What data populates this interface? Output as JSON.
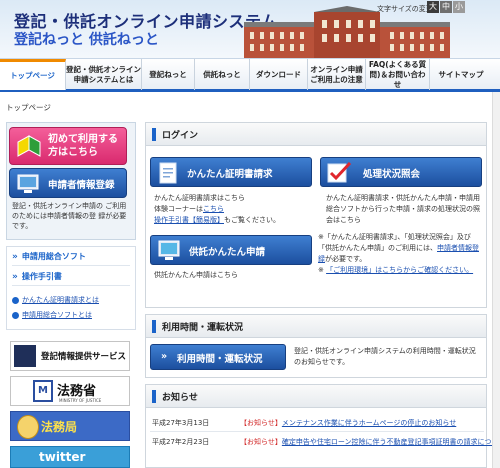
{
  "header": {
    "title": "登記・供託オンライン申請システム",
    "subtitle": "登記ねっと 供託ねっと",
    "font_size_label": "文字サイズの変更",
    "font_size_options": [
      "大",
      "中",
      "小"
    ]
  },
  "nav": {
    "items": [
      {
        "label": "トップページ",
        "active": true
      },
      {
        "label": "登記・供託オンライン申請システムとは",
        "active": false
      },
      {
        "label": "登記ねっと",
        "active": false
      },
      {
        "label": "供託ねっと",
        "active": false
      },
      {
        "label": "ダウンロード",
        "active": false
      },
      {
        "label": "オンライン申請ご利用上の注意",
        "active": false
      },
      {
        "label": "FAQ(よくある質問)＆お問い合わせ",
        "active": false
      },
      {
        "label": "サイトマップ",
        "active": false
      }
    ]
  },
  "breadcrumb": "トップページ",
  "left": {
    "first_time_button": "初めて利用する方はこちら",
    "register_button": "申請者情報登録",
    "register_note": "登記・供託オンライン申請の ご利用のためには申請者情報の登 録が必要です。",
    "links": [
      "申請用総合ソフト",
      "操作手引書"
    ],
    "sub_links": [
      "かんたん証明書請求とは",
      "申請用総合ソフトとは"
    ],
    "banners": {
      "touki": "登記情報提供サービス",
      "moj_mark": "M",
      "moj_title": "法務省",
      "moj_sub": "MINISTRY OF JUSTICE",
      "kyoku": "法務局",
      "twitter": "twitter"
    }
  },
  "login": {
    "heading": "ログイン",
    "cert_button": "かんたん証明書請求",
    "cert_text_1": "かんたん証明書請求はこちら",
    "cert_text_2_prefix": "体験コーナーは",
    "cert_text_2_link": "こちら",
    "cert_text_3_link": "操作手引書【簡易版】",
    "cert_text_3_suffix": "もご覧ください。",
    "deposit_button": "供託かんたん申請",
    "deposit_text": "供託かんたん申請はこちら",
    "status_button": "処理状況照会",
    "status_text": "かんたん証明書請求・供託かんたん申請・申請用総合ソフトから行った申請・請求の処理状況の照会はこちら",
    "note_1_prefix": "※「かんたん証明書請求」、「処理状況照会」及び「供託かんたん申請」のご利用には、",
    "note_1_link": "申請者情報登録",
    "note_1_suffix": "が必要です。",
    "note_2_link": "「ご利用環境」はこちらからご確認ください。"
  },
  "hours": {
    "heading": "利用時間・運転状況",
    "button": "利用時間・運転状況",
    "text": "登記・供託オンライン申請システムの利用時間・運転状況のお知らせです。"
  },
  "news": {
    "heading": "お知らせ",
    "items": [
      {
        "date": "平成27年3月13日",
        "tag": "【お知らせ】",
        "text": "メンテナンス作業に伴うホームページの停止のお知らせ"
      },
      {
        "date": "平成27年2月23日",
        "tag": "【お知らせ】",
        "text": "確定申告や住宅ローン控除に伴う不動産登記事項証明書の請求について"
      }
    ]
  }
}
